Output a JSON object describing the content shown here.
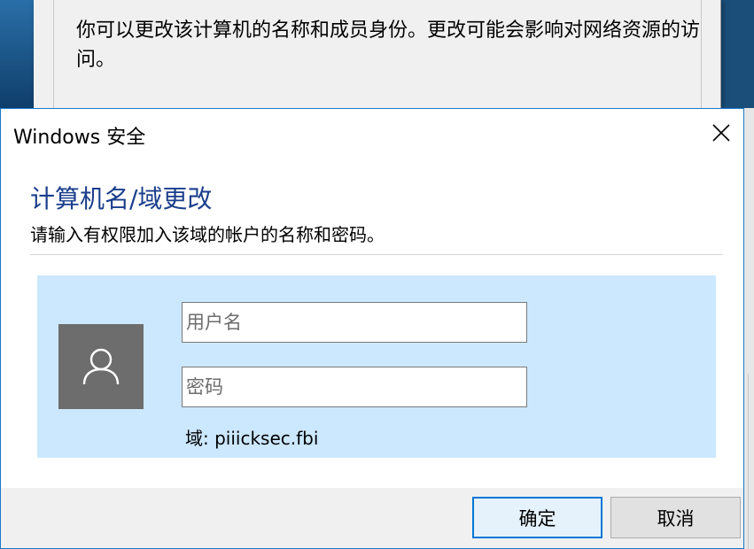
{
  "background_window": {
    "description_text": "你可以更改该计算机的名称和成员身份。更改可能会影响对网络资源的访问。"
  },
  "dialog": {
    "title": "Windows 安全",
    "heading": "计算机名/域更改",
    "subheading": "请输入有权限加入该域的帐户的名称和密码。",
    "username_placeholder": "用户名",
    "username_value": "",
    "password_placeholder": "密码",
    "password_value": "",
    "domain_label": "域: piiicksec.fbi",
    "ok_label": "确定",
    "cancel_label": "取消"
  },
  "icons": {
    "close": "close-icon",
    "avatar": "user-avatar-icon"
  },
  "colors": {
    "accent": "#0078d7",
    "heading": "#1a3e8c",
    "credential_panel": "#cce8ff",
    "avatar_bg": "#6d6d6d",
    "dialog_border": "#1979ca"
  }
}
